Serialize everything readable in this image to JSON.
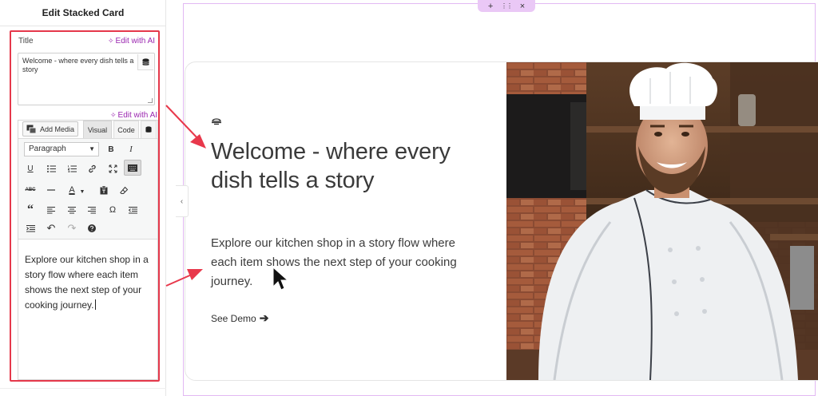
{
  "panel": {
    "title": "Edit Stacked Card",
    "title_field_label": "Title",
    "edit_with_ai_label": "Edit with AI",
    "title_value": "Welcome - where every dish tells a story",
    "add_media_label": "Add Media",
    "tabs": {
      "visual": "Visual",
      "code": "Code"
    },
    "format_select_value": "Paragraph",
    "toolbar_row1": [
      "bold",
      "italic"
    ],
    "description_value": "Explore our kitchen shop in a story flow where each item shows the next step of your cooking journey."
  },
  "card": {
    "heading": "Welcome - where every dish tells a story",
    "description": "Explore our kitchen shop in a story flow where each item shows the next step of your cooking journey.",
    "cta_label": "See Demo",
    "image_alt": "chef-in-kitchen"
  },
  "section_handle": {
    "add": "+",
    "move": "⋮⋮",
    "close": "×"
  },
  "colors": {
    "highlight": "#e5384b",
    "ai_purple": "#9b27b0",
    "section_outline": "#e2b9f3",
    "annotation_arrow": "#e8384b"
  }
}
